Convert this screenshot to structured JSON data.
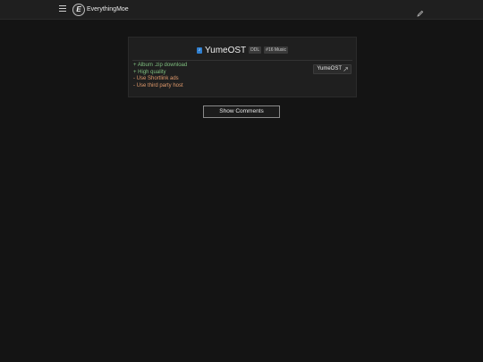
{
  "navbar": {
    "brand_logo_letter": "E",
    "brand_name": "EverythingMoe",
    "menu_icon": "hamburger-icon",
    "edit_icon": "pencil-icon"
  },
  "card": {
    "title_icon": "music-note-icon",
    "title": "YumeOST",
    "tags": [
      "DDL",
      "#16 Music"
    ],
    "features": [
      {
        "text": "+ Album .zip download",
        "type": "pro"
      },
      {
        "text": "+ High quality",
        "type": "pro"
      },
      {
        "text": "- Use Shortlink ads",
        "type": "con"
      },
      {
        "text": "- Use third party host",
        "type": "con"
      }
    ],
    "link_label": "YumeOST",
    "link_icon": "external-link-icon"
  },
  "comments": {
    "button_label": "Show Comments"
  },
  "colors": {
    "background": "#141414",
    "pro": "#7fbf7f",
    "con": "#e09a6c",
    "accent": "#2f7fd0"
  }
}
